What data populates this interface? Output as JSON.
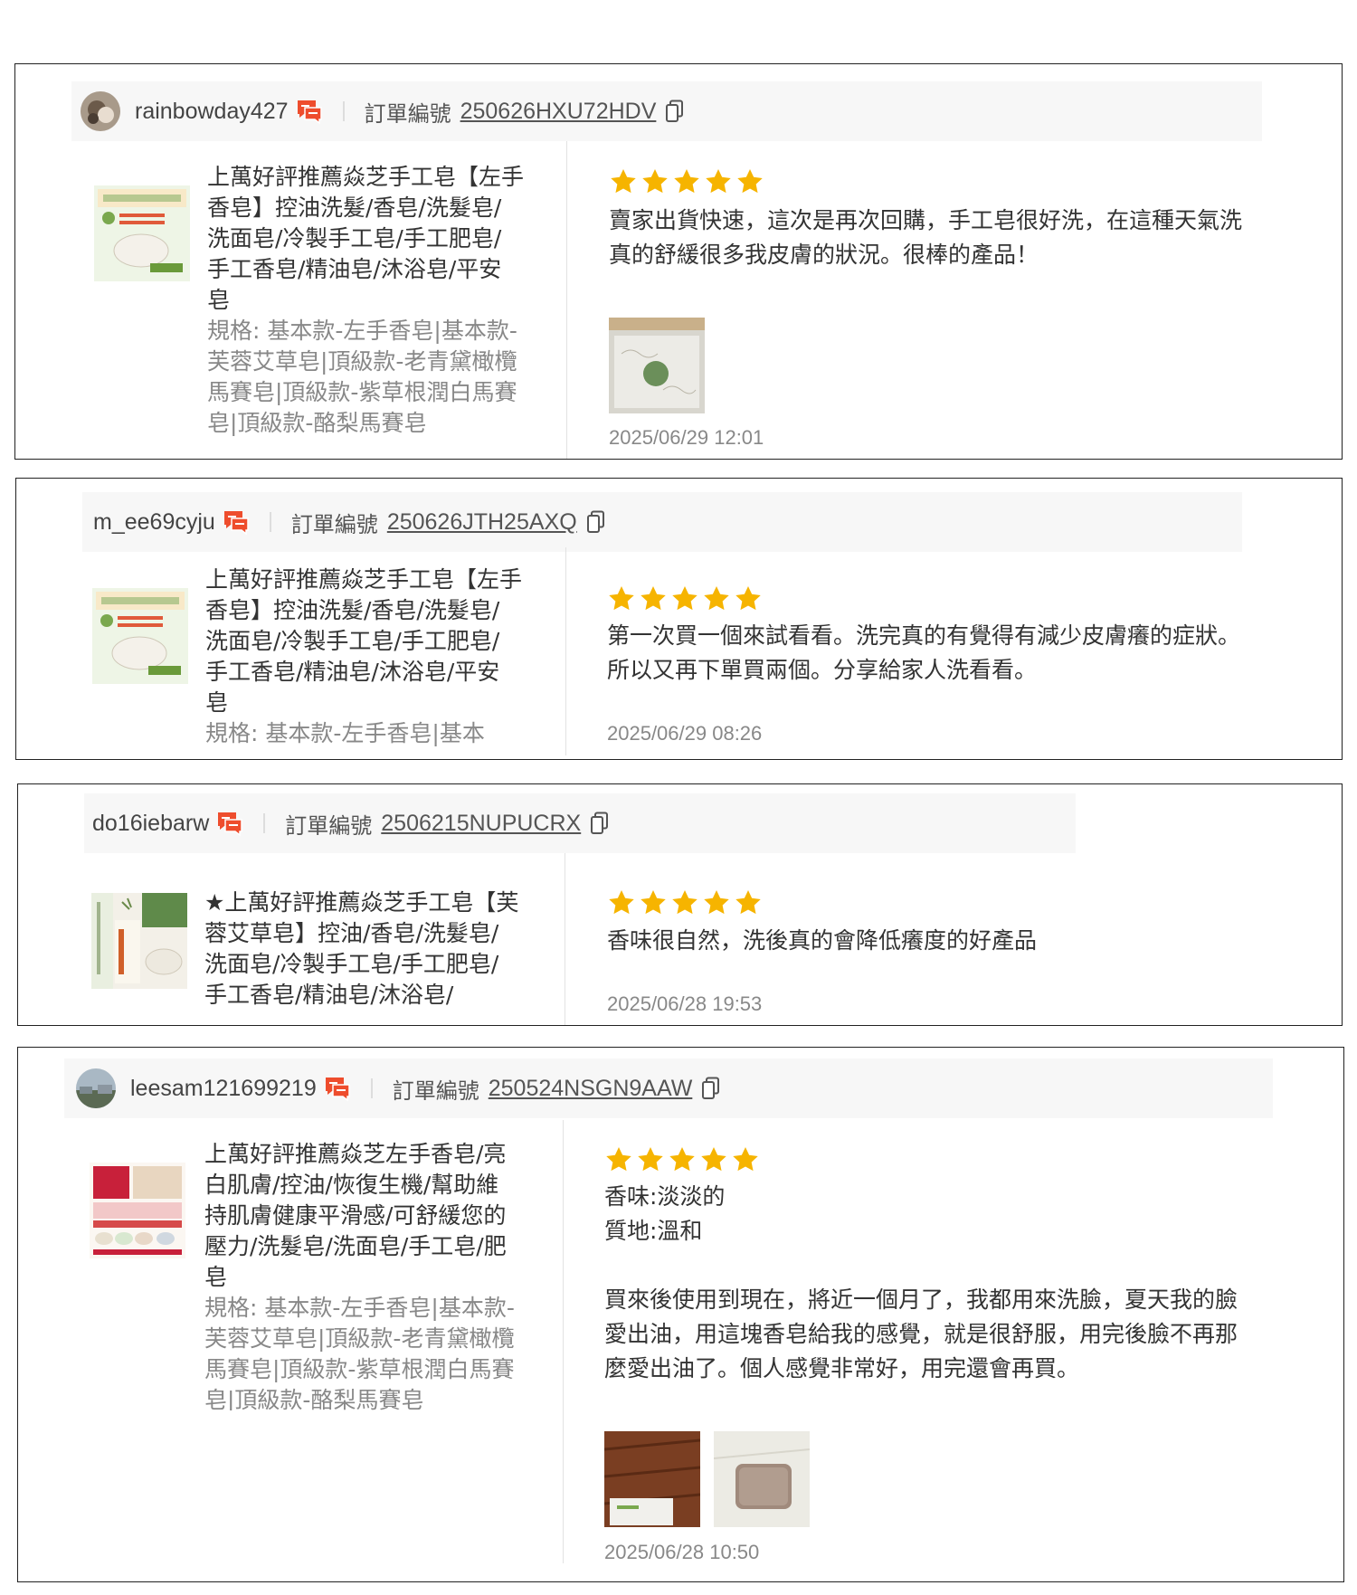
{
  "reviews": [
    {
      "username": "rainbowday427",
      "order_label": "訂單編號",
      "order_number": "250626HXU72HDV",
      "product_name": "上萬好評推薦焱芝手工皂【左手香皂】控油洗髮/香皂/洗髮皂/洗面皂/冷製手工皂/手工肥皂/手工香皂/精油皂/沐浴皂/平安皂",
      "product_spec": "規格: 基本款-左手香皂|基本款-芙蓉艾草皂|頂級款-老青黛橄欖馬賽皂|頂級款-紫草根潤白馬賽皂|頂級款-酪梨馬賽皂",
      "rating": 5,
      "text": "賣家出貨快速，這次是再次回購，手工皂很好洗，在這種天氣洗真的舒緩很多我皮膚的狀況。很棒的產品！",
      "date": "2025/06/29 12:01"
    },
    {
      "username": "m_ee69cyju",
      "order_label": "訂單編號",
      "order_number": "250626JTH25AXQ",
      "product_name": "上萬好評推薦焱芝手工皂【左手香皂】控油洗髮/香皂/洗髮皂/洗面皂/冷製手工皂/手工肥皂/手工香皂/精油皂/沐浴皂/平安皂",
      "product_spec": "規格: 基本款-左手香皂|基本",
      "rating": 5,
      "text": "第一次買一個來試看看。洗完真的有覺得有減少皮膚癢的症狀。所以又再下單買兩個。分享給家人洗看看。",
      "date": "2025/06/29 08:26"
    },
    {
      "username": "do16iebarw",
      "order_label": "訂單編號",
      "order_number": "2506215NUPUCRX",
      "product_name": "★上萬好評推薦焱芝手工皂【芙蓉艾草皂】控油/香皂/洗髮皂/洗面皂/冷製手工皂/手工肥皂/手工香皂/精油皂/沐浴皂/",
      "product_spec": "",
      "rating": 5,
      "text": "香味很自然，洗後真的會降低癢度的好產品",
      "date": "2025/06/28 19:53"
    },
    {
      "username": "leesam121699219",
      "order_label": "訂單編號",
      "order_number": "250524NSGN9AAW",
      "product_name": "上萬好評推薦焱芝左手香皂/亮白肌膚/控油/恢復生機/幫助維持肌膚健康平滑感/可舒緩您的壓力/洗髮皂/洗面皂/手工皂/肥皂",
      "product_spec": "規格: 基本款-左手香皂|基本款-芙蓉艾草皂|頂級款-老青黛橄欖馬賽皂|頂級款-紫草根潤白馬賽皂|頂級款-酪梨馬賽皂",
      "rating": 5,
      "text": "香味:淡淡的\n質地:溫和\n\n買來後使用到現在，將近一個月了，我都用來洗臉，夏天我的臉愛出油，用這塊香皂給我的感覺，就是很舒服，用完後臉不再那麼愛出油了。個人感覺非常好，用完還會再買。",
      "date": "2025/06/28 10:50"
    }
  ],
  "colors": {
    "star": "#f6b400",
    "chat": "#ee4d2d",
    "border": "#222222",
    "header_bg": "#f7f7f7"
  },
  "icons": {
    "chat": "chat-icon",
    "copy": "copy-icon",
    "star": "star-icon"
  }
}
